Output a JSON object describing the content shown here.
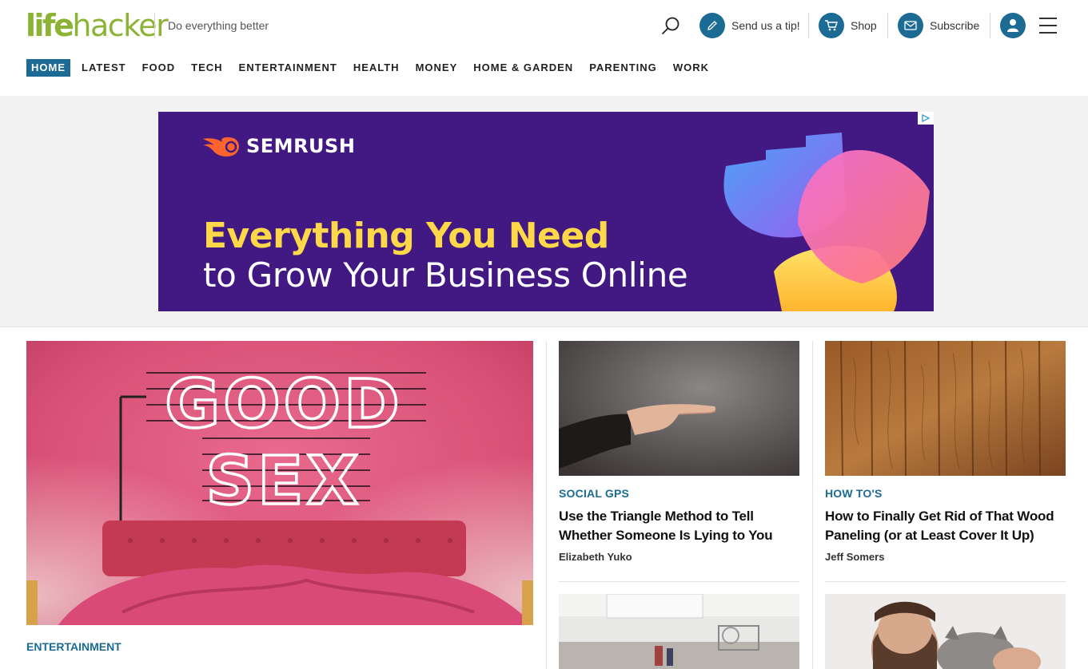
{
  "site": {
    "logo_part1": "life",
    "logo_part2": "hacker",
    "tagline": "Do everything better"
  },
  "header_actions": {
    "tip_label": "Send us a tip!",
    "shop_label": "Shop",
    "subscribe_label": "Subscribe"
  },
  "nav": {
    "items": [
      "HOME",
      "LATEST",
      "FOOD",
      "TECH",
      "ENTERTAINMENT",
      "HEALTH",
      "MONEY",
      "HOME & GARDEN",
      "PARENTING",
      "WORK"
    ],
    "active": "HOME"
  },
  "ad": {
    "brand": "SEMRUSH",
    "headline_line1": "Everything You Need",
    "headline_line2": "to Grow Your Business Online",
    "background_color": "#421983",
    "headline_color": "#ffd84a"
  },
  "lead_story": {
    "category": "ENTERTAINMENT",
    "image_text_line1": "GOOD",
    "image_text_line2": "SEX"
  },
  "cards": [
    {
      "category": "SOCIAL GPS",
      "title": "Use the Triangle Method to Tell Whether Someone Is Lying to You",
      "author": "Elizabeth Yuko"
    },
    {
      "category": "HOW TO'S",
      "title": "How to Finally Get Rid of That Wood Paneling (or at Least Cover It Up)",
      "author": "Jeff Somers"
    }
  ],
  "colors": {
    "brand_blue": "#1c6b94",
    "logo_green": "#8cb336"
  }
}
